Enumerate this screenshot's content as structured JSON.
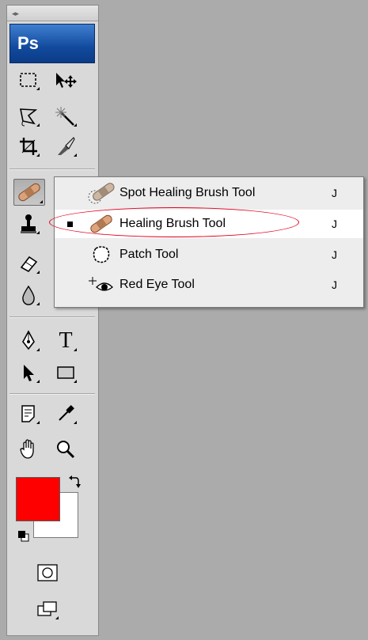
{
  "toolbox": {
    "logo": "Ps",
    "grip_glyph": "◂▸",
    "tools": [
      {
        "name": "rectangular-marquee-tool",
        "icon": "marquee-icon"
      },
      {
        "name": "move-tool",
        "icon": "move-icon"
      },
      {
        "name": "lasso-tool",
        "icon": "polygonal-lasso-icon"
      },
      {
        "name": "magic-wand-tool",
        "icon": "magic-wand-icon"
      },
      {
        "name": "crop-tool",
        "icon": "crop-icon"
      },
      {
        "name": "slice-tool",
        "icon": "slice-icon"
      },
      {
        "name": "healing-brush-tool",
        "icon": "bandage-icon",
        "active": true
      },
      {
        "name": "clone-stamp-tool",
        "icon": "stamp-icon"
      },
      {
        "name": "eraser-tool",
        "icon": "eraser-icon"
      },
      {
        "name": "blur-tool",
        "icon": "drop-icon"
      },
      {
        "name": "pen-tool",
        "icon": "pen-icon"
      },
      {
        "name": "type-tool",
        "icon": "type-icon",
        "glyph": "T"
      },
      {
        "name": "path-selection-tool",
        "icon": "arrow-icon"
      },
      {
        "name": "shape-tool",
        "icon": "rectangle-icon"
      },
      {
        "name": "notes-tool",
        "icon": "notes-icon"
      },
      {
        "name": "eyedropper-tool",
        "icon": "eyedropper-icon"
      },
      {
        "name": "hand-tool",
        "icon": "hand-icon"
      },
      {
        "name": "zoom-tool",
        "icon": "magnifier-icon"
      },
      {
        "name": "quick-mask-mode",
        "icon": "quick-mask-icon"
      },
      {
        "name": "screen-mode",
        "icon": "screen-mode-icon"
      }
    ],
    "colors": {
      "foreground": "#ff0000",
      "background": "#ffffff"
    }
  },
  "flyout": {
    "items": [
      {
        "label": "Spot Healing Brush Tool",
        "shortcut": "J",
        "icon": "spot-healing-bandage-icon",
        "selected": false
      },
      {
        "label": "Healing Brush Tool",
        "shortcut": "J",
        "icon": "bandage-icon",
        "selected": true
      },
      {
        "label": "Patch Tool",
        "shortcut": "J",
        "icon": "patch-icon",
        "selected": false
      },
      {
        "label": "Red Eye Tool",
        "shortcut": "J",
        "icon": "red-eye-icon",
        "selected": false
      }
    ],
    "highlight_color": "#e0001b"
  }
}
